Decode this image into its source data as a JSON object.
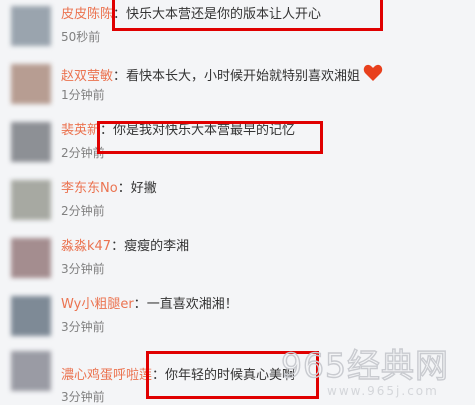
{
  "comments": [
    {
      "name": "皮皮陈陈",
      "text": "快乐大本营还是你的版本让人开心",
      "time": "50秒前",
      "avatar_color": "#9aa4ae"
    },
    {
      "name": "赵双莹敏",
      "text": "看快本长大，小时候开始就特别喜欢湘姐",
      "time": "1分钟前",
      "avatar_color": "#b79d92"
    },
    {
      "name": "裴英新",
      "text": "你是我对快乐大本营最早的记忆",
      "time": "2分钟前",
      "avatar_color": "#8d9095"
    },
    {
      "name": "李东东No",
      "text": "好撇",
      "time": "2分钟前",
      "avatar_color": "#a7a9a2"
    },
    {
      "name": "淼淼k47",
      "text": "瘦瘦的李湘",
      "time": "3分钟前",
      "avatar_color": "#a48d8f"
    },
    {
      "name": "Wy小粗腿er",
      "text": "一直喜欢湘湘！",
      "time": "3分钟前",
      "avatar_color": "#7e8a96"
    },
    {
      "name": "濃心鸡蛋呼啦莲",
      "text": "你年轻的时候真心美啊",
      "time": "3分钟前",
      "avatar_color": "#9a9ba4"
    }
  ],
  "separator": "：",
  "watermark": {
    "text": "965经典网",
    "url": "www.965j.com"
  },
  "colors": {
    "name": "#eb7350",
    "highlight": "#e00000",
    "heart": "#e8401d"
  }
}
